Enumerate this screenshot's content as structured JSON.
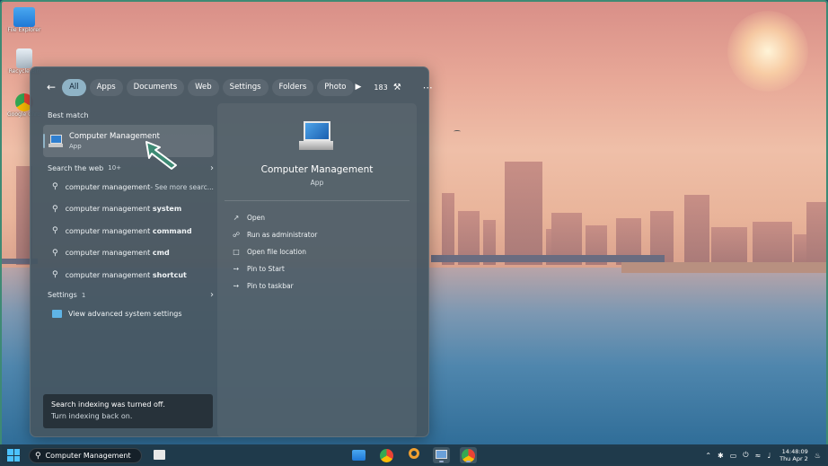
{
  "desktop": {
    "icons": [
      {
        "label": "File Explorer"
      },
      {
        "label": "Recycle Bin"
      },
      {
        "label": "Google Chrome"
      }
    ]
  },
  "search_panel": {
    "filters": [
      "All",
      "Apps",
      "Documents",
      "Web",
      "Settings",
      "Folders",
      "Photo"
    ],
    "active_filter": "All",
    "points": "183",
    "best_match": {
      "heading": "Best match",
      "title": "Computer Management",
      "type": "App"
    },
    "web": {
      "heading": "Search the web",
      "count": "10+",
      "items": [
        {
          "prefix": "computer management",
          "bold": "",
          "suffix": " - See more searc..."
        },
        {
          "prefix": "computer management ",
          "bold": "system",
          "suffix": ""
        },
        {
          "prefix": "computer management ",
          "bold": "command",
          "suffix": ""
        },
        {
          "prefix": "computer management ",
          "bold": "cmd",
          "suffix": ""
        },
        {
          "prefix": "computer management ",
          "bold": "shortcut",
          "suffix": ""
        }
      ]
    },
    "settings": {
      "heading": "Settings",
      "count": "1",
      "items": [
        "View advanced system settings"
      ]
    },
    "indexing_notice": {
      "line1": "Search indexing was turned off.",
      "line2": "Turn indexing back on."
    },
    "details": {
      "title": "Computer Management",
      "subtitle": "App",
      "actions": [
        "Open",
        "Run as administrator",
        "Open file location",
        "Pin to Start",
        "Pin to taskbar"
      ]
    }
  },
  "taskbar": {
    "search_value": "Computer Management",
    "clock_time": "14:48:09",
    "clock_date": "Thu Apr 2"
  },
  "colors": {
    "accent": "#8fb3c6",
    "panel": "#465662",
    "taskbar": "#203a4a",
    "cursor": "#3e8a74"
  }
}
